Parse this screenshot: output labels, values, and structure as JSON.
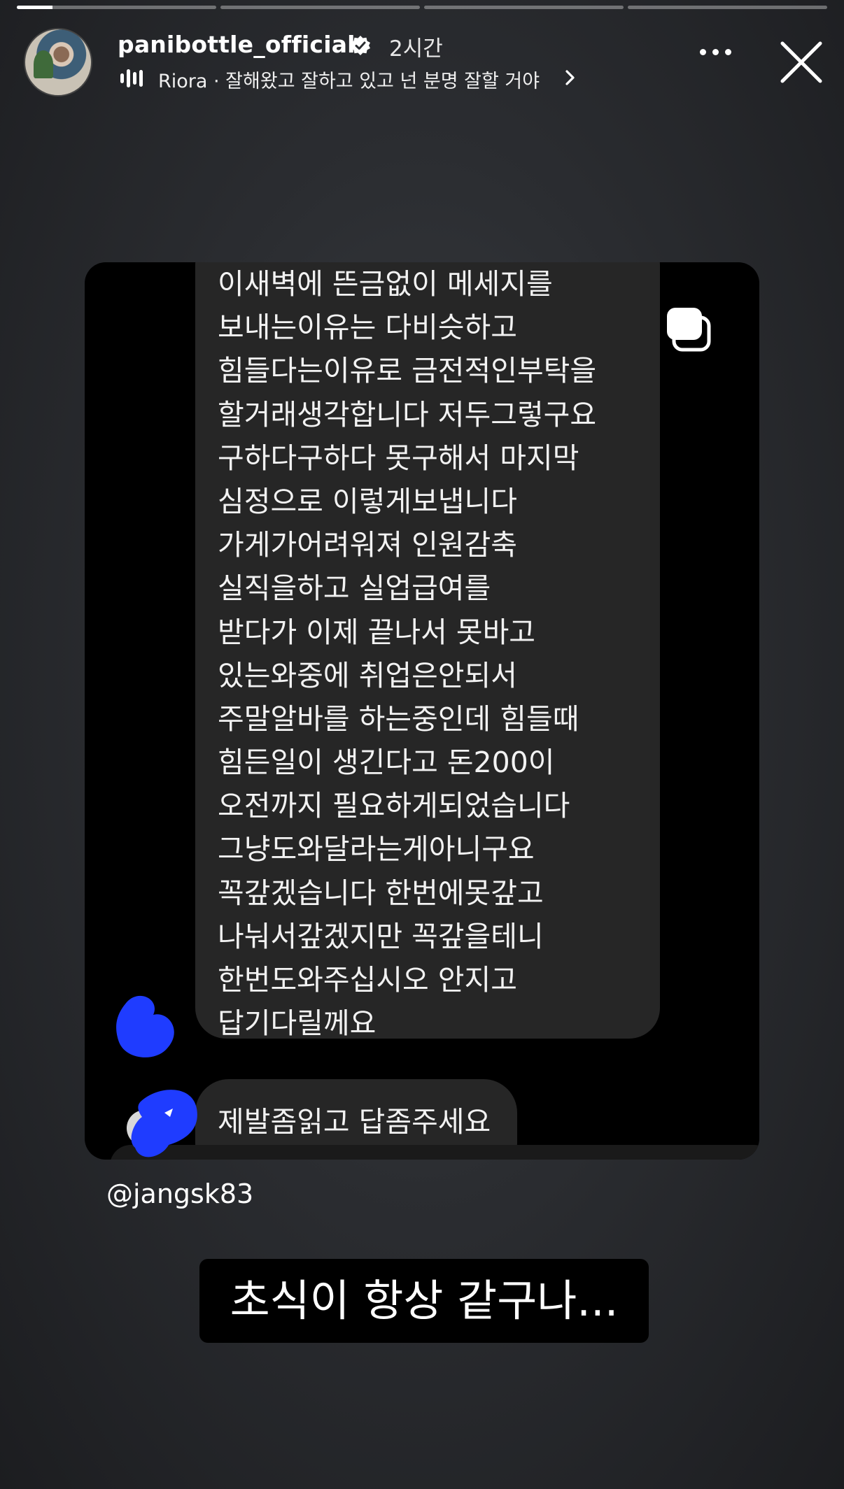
{
  "story": {
    "progress": [
      1,
      0,
      0,
      0
    ],
    "first_segment_fill_fraction": 0.18
  },
  "header": {
    "username": "panibottle_official",
    "time_ago": "2시간",
    "music": "Riora · 잘해왔고 잘하고 있고 넌 분명 잘할 거야"
  },
  "message": {
    "lines": [
      "이새벽에 뜬금없이  메세지를",
      "보내는이유는 다비슷하고",
      "힘들다는이유로  금전적인부탁을",
      "할거래생각합니다 저두그렇구요",
      "구하다구하다 못구해서  마지막",
      "심정으로 이렇게보냅니다",
      "가게가어려워져  인원감축",
      "실직을하고  실업급여를",
      "받다가  이제 끝나서 못바고",
      "있는와중에  취업은안되서",
      "주말알바를 하는중인데 힘들때",
      "힘든일이 생긴다고  돈200이",
      "오전까지 필요하게되었습니다",
      "그냥도와달라는게아니구요",
      "꼭갚겠습니다 한번에못갚고",
      "나눠서갚겠지만  꼭갚을테니",
      "한번도와주십시오  안지고",
      "답기다릴께요"
    ],
    "followup": "제발좀읽고 답좀주세요"
  },
  "mention": "@jangsk83",
  "caption": "초식이 항상 같구나...",
  "colors": {
    "scribble": "#1f3cff",
    "bubble": "#262626"
  }
}
